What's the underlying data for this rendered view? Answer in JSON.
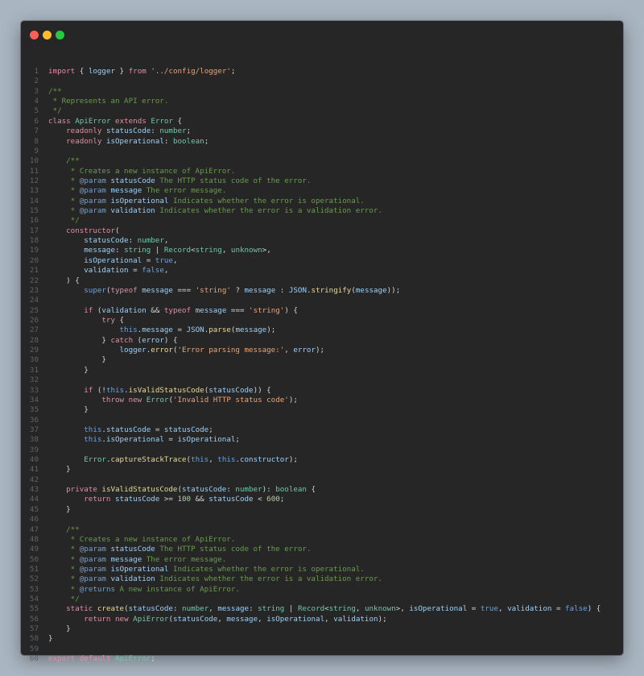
{
  "window": {
    "controls": [
      {
        "name": "close-dot",
        "color": "#ff5f57"
      },
      {
        "name": "minimize-dot",
        "color": "#febc2e"
      },
      {
        "name": "maximize-dot",
        "color": "#28c840"
      }
    ]
  },
  "code": {
    "lines": [
      [
        [
          "kw",
          "import"
        ],
        [
          "pl",
          " { "
        ],
        [
          "var",
          "logger"
        ],
        [
          "pl",
          " } "
        ],
        [
          "kw",
          "from"
        ],
        [
          "pl",
          " "
        ],
        [
          "str",
          "'../config/logger'"
        ],
        [
          "pl",
          ";"
        ]
      ],
      [],
      [
        [
          "cm",
          "/**"
        ]
      ],
      [
        [
          "cm",
          " * Represents an API error."
        ]
      ],
      [
        [
          "cm",
          " */"
        ]
      ],
      [
        [
          "kw",
          "class"
        ],
        [
          "pl",
          " "
        ],
        [
          "ty",
          "ApiError"
        ],
        [
          "pl",
          " "
        ],
        [
          "kw",
          "extends"
        ],
        [
          "pl",
          " "
        ],
        [
          "ty",
          "Error"
        ],
        [
          "pl",
          " {"
        ]
      ],
      [
        [
          "pl",
          "    "
        ],
        [
          "kw",
          "readonly"
        ],
        [
          "pl",
          " "
        ],
        [
          "var",
          "statusCode"
        ],
        [
          "pl",
          ": "
        ],
        [
          "ty",
          "number"
        ],
        [
          "pl",
          ";"
        ]
      ],
      [
        [
          "pl",
          "    "
        ],
        [
          "kw",
          "readonly"
        ],
        [
          "pl",
          " "
        ],
        [
          "var",
          "isOperational"
        ],
        [
          "pl",
          ": "
        ],
        [
          "ty",
          "boolean"
        ],
        [
          "pl",
          ";"
        ]
      ],
      [],
      [
        [
          "pl",
          "    "
        ],
        [
          "cm",
          "/**"
        ]
      ],
      [
        [
          "pl",
          "    "
        ],
        [
          "cm",
          " * Creates a new instance of ApiError."
        ]
      ],
      [
        [
          "pl",
          "    "
        ],
        [
          "cm",
          " * "
        ],
        [
          "cmtag",
          "@param"
        ],
        [
          "pl",
          " "
        ],
        [
          "var",
          "statusCode"
        ],
        [
          "cm",
          " The HTTP status code of the error."
        ]
      ],
      [
        [
          "pl",
          "    "
        ],
        [
          "cm",
          " * "
        ],
        [
          "cmtag",
          "@param"
        ],
        [
          "pl",
          " "
        ],
        [
          "var",
          "message"
        ],
        [
          "cm",
          " The error message."
        ]
      ],
      [
        [
          "pl",
          "    "
        ],
        [
          "cm",
          " * "
        ],
        [
          "cmtag",
          "@param"
        ],
        [
          "pl",
          " "
        ],
        [
          "var",
          "isOperational"
        ],
        [
          "cm",
          " Indicates whether the error is operational."
        ]
      ],
      [
        [
          "pl",
          "    "
        ],
        [
          "cm",
          " * "
        ],
        [
          "cmtag",
          "@param"
        ],
        [
          "pl",
          " "
        ],
        [
          "var",
          "validation"
        ],
        [
          "cm",
          " Indicates whether the error is a validation error."
        ]
      ],
      [
        [
          "pl",
          "    "
        ],
        [
          "cm",
          " */"
        ]
      ],
      [
        [
          "pl",
          "    "
        ],
        [
          "kw",
          "constructor"
        ],
        [
          "pl",
          "("
        ]
      ],
      [
        [
          "pl",
          "        "
        ],
        [
          "var",
          "statusCode"
        ],
        [
          "pl",
          ": "
        ],
        [
          "ty",
          "number"
        ],
        [
          "pl",
          ","
        ]
      ],
      [
        [
          "pl",
          "        "
        ],
        [
          "var",
          "message"
        ],
        [
          "pl",
          ": "
        ],
        [
          "ty",
          "string"
        ],
        [
          "pl",
          " | "
        ],
        [
          "ty",
          "Record"
        ],
        [
          "pl",
          "<"
        ],
        [
          "ty",
          "string"
        ],
        [
          "pl",
          ", "
        ],
        [
          "ty",
          "unknown"
        ],
        [
          "pl",
          ">,"
        ]
      ],
      [
        [
          "pl",
          "        "
        ],
        [
          "var",
          "isOperational"
        ],
        [
          "pl",
          " = "
        ],
        [
          "kw2",
          "true"
        ],
        [
          "pl",
          ","
        ]
      ],
      [
        [
          "pl",
          "        "
        ],
        [
          "var",
          "validation"
        ],
        [
          "pl",
          " = "
        ],
        [
          "kw2",
          "false"
        ],
        [
          "pl",
          ","
        ]
      ],
      [
        [
          "pl",
          "    ) {"
        ]
      ],
      [
        [
          "pl",
          "        "
        ],
        [
          "kw2",
          "super"
        ],
        [
          "pl",
          "("
        ],
        [
          "kw",
          "typeof"
        ],
        [
          "pl",
          " "
        ],
        [
          "var",
          "message"
        ],
        [
          "pl",
          " === "
        ],
        [
          "str",
          "'string'"
        ],
        [
          "pl",
          " ? "
        ],
        [
          "var",
          "message"
        ],
        [
          "pl",
          " : "
        ],
        [
          "var",
          "JSON"
        ],
        [
          "pl",
          "."
        ],
        [
          "fn",
          "stringify"
        ],
        [
          "pl",
          "("
        ],
        [
          "var",
          "message"
        ],
        [
          "pl",
          "));"
        ]
      ],
      [],
      [
        [
          "pl",
          "        "
        ],
        [
          "kw",
          "if"
        ],
        [
          "pl",
          " ("
        ],
        [
          "var",
          "validation"
        ],
        [
          "pl",
          " && "
        ],
        [
          "kw",
          "typeof"
        ],
        [
          "pl",
          " "
        ],
        [
          "var",
          "message"
        ],
        [
          "pl",
          " === "
        ],
        [
          "str",
          "'string'"
        ],
        [
          "pl",
          ") {"
        ]
      ],
      [
        [
          "pl",
          "            "
        ],
        [
          "kw",
          "try"
        ],
        [
          "pl",
          " {"
        ]
      ],
      [
        [
          "pl",
          "                "
        ],
        [
          "kw2",
          "this"
        ],
        [
          "pl",
          "."
        ],
        [
          "var",
          "message"
        ],
        [
          "pl",
          " = "
        ],
        [
          "var",
          "JSON"
        ],
        [
          "pl",
          "."
        ],
        [
          "fn",
          "parse"
        ],
        [
          "pl",
          "("
        ],
        [
          "var",
          "message"
        ],
        [
          "pl",
          ");"
        ]
      ],
      [
        [
          "pl",
          "            } "
        ],
        [
          "kw",
          "catch"
        ],
        [
          "pl",
          " ("
        ],
        [
          "var",
          "error"
        ],
        [
          "pl",
          ") {"
        ]
      ],
      [
        [
          "pl",
          "                "
        ],
        [
          "var",
          "logger"
        ],
        [
          "pl",
          "."
        ],
        [
          "fn",
          "error"
        ],
        [
          "pl",
          "("
        ],
        [
          "str",
          "'Error parsing message:'"
        ],
        [
          "pl",
          ", "
        ],
        [
          "var",
          "error"
        ],
        [
          "pl",
          ");"
        ]
      ],
      [
        [
          "pl",
          "            }"
        ]
      ],
      [
        [
          "pl",
          "        }"
        ]
      ],
      [],
      [
        [
          "pl",
          "        "
        ],
        [
          "kw",
          "if"
        ],
        [
          "pl",
          " (!"
        ],
        [
          "kw2",
          "this"
        ],
        [
          "pl",
          "."
        ],
        [
          "fn",
          "isValidStatusCode"
        ],
        [
          "pl",
          "("
        ],
        [
          "var",
          "statusCode"
        ],
        [
          "pl",
          ")) {"
        ]
      ],
      [
        [
          "pl",
          "            "
        ],
        [
          "kw",
          "throw"
        ],
        [
          "pl",
          " "
        ],
        [
          "kw",
          "new"
        ],
        [
          "pl",
          " "
        ],
        [
          "ty",
          "Error"
        ],
        [
          "pl",
          "("
        ],
        [
          "str",
          "'Invalid HTTP status code'"
        ],
        [
          "pl",
          ");"
        ]
      ],
      [
        [
          "pl",
          "        }"
        ]
      ],
      [],
      [
        [
          "pl",
          "        "
        ],
        [
          "kw2",
          "this"
        ],
        [
          "pl",
          "."
        ],
        [
          "var",
          "statusCode"
        ],
        [
          "pl",
          " = "
        ],
        [
          "var",
          "statusCode"
        ],
        [
          "pl",
          ";"
        ]
      ],
      [
        [
          "pl",
          "        "
        ],
        [
          "kw2",
          "this"
        ],
        [
          "pl",
          "."
        ],
        [
          "var",
          "isOperational"
        ],
        [
          "pl",
          " = "
        ],
        [
          "var",
          "isOperational"
        ],
        [
          "pl",
          ";"
        ]
      ],
      [],
      [
        [
          "pl",
          "        "
        ],
        [
          "ty",
          "Error"
        ],
        [
          "pl",
          "."
        ],
        [
          "fn",
          "captureStackTrace"
        ],
        [
          "pl",
          "("
        ],
        [
          "kw2",
          "this"
        ],
        [
          "pl",
          ", "
        ],
        [
          "kw2",
          "this"
        ],
        [
          "pl",
          "."
        ],
        [
          "var",
          "constructor"
        ],
        [
          "pl",
          ");"
        ]
      ],
      [
        [
          "pl",
          "    }"
        ]
      ],
      [],
      [
        [
          "pl",
          "    "
        ],
        [
          "kw",
          "private"
        ],
        [
          "pl",
          " "
        ],
        [
          "fn",
          "isValidStatusCode"
        ],
        [
          "pl",
          "("
        ],
        [
          "var",
          "statusCode"
        ],
        [
          "pl",
          ": "
        ],
        [
          "ty",
          "number"
        ],
        [
          "pl",
          "): "
        ],
        [
          "ty",
          "boolean"
        ],
        [
          "pl",
          " {"
        ]
      ],
      [
        [
          "pl",
          "        "
        ],
        [
          "kw",
          "return"
        ],
        [
          "pl",
          " "
        ],
        [
          "var",
          "statusCode"
        ],
        [
          "pl",
          " >= "
        ],
        [
          "num",
          "100"
        ],
        [
          "pl",
          " && "
        ],
        [
          "var",
          "statusCode"
        ],
        [
          "pl",
          " < "
        ],
        [
          "num",
          "600"
        ],
        [
          "pl",
          ";"
        ]
      ],
      [
        [
          "pl",
          "    }"
        ]
      ],
      [],
      [
        [
          "pl",
          "    "
        ],
        [
          "cm",
          "/**"
        ]
      ],
      [
        [
          "pl",
          "    "
        ],
        [
          "cm",
          " * Creates a new instance of ApiError."
        ]
      ],
      [
        [
          "pl",
          "    "
        ],
        [
          "cm",
          " * "
        ],
        [
          "cmtag",
          "@param"
        ],
        [
          "pl",
          " "
        ],
        [
          "var",
          "statusCode"
        ],
        [
          "cm",
          " The HTTP status code of the error."
        ]
      ],
      [
        [
          "pl",
          "    "
        ],
        [
          "cm",
          " * "
        ],
        [
          "cmtag",
          "@param"
        ],
        [
          "pl",
          " "
        ],
        [
          "var",
          "message"
        ],
        [
          "cm",
          " The error message."
        ]
      ],
      [
        [
          "pl",
          "    "
        ],
        [
          "cm",
          " * "
        ],
        [
          "cmtag",
          "@param"
        ],
        [
          "pl",
          " "
        ],
        [
          "var",
          "isOperational"
        ],
        [
          "cm",
          " Indicates whether the error is operational."
        ]
      ],
      [
        [
          "pl",
          "    "
        ],
        [
          "cm",
          " * "
        ],
        [
          "cmtag",
          "@param"
        ],
        [
          "pl",
          " "
        ],
        [
          "var",
          "validation"
        ],
        [
          "cm",
          " Indicates whether the error is a validation error."
        ]
      ],
      [
        [
          "pl",
          "    "
        ],
        [
          "cm",
          " * "
        ],
        [
          "cmtag",
          "@returns"
        ],
        [
          "cm",
          " A new instance of ApiError."
        ]
      ],
      [
        [
          "pl",
          "    "
        ],
        [
          "cm",
          " */"
        ]
      ],
      [
        [
          "pl",
          "    "
        ],
        [
          "kw",
          "static"
        ],
        [
          "pl",
          " "
        ],
        [
          "fn",
          "create"
        ],
        [
          "pl",
          "("
        ],
        [
          "var",
          "statusCode"
        ],
        [
          "pl",
          ": "
        ],
        [
          "ty",
          "number"
        ],
        [
          "pl",
          ", "
        ],
        [
          "var",
          "message"
        ],
        [
          "pl",
          ": "
        ],
        [
          "ty",
          "string"
        ],
        [
          "pl",
          " | "
        ],
        [
          "ty",
          "Record"
        ],
        [
          "pl",
          "<"
        ],
        [
          "ty",
          "string"
        ],
        [
          "pl",
          ", "
        ],
        [
          "ty",
          "unknown"
        ],
        [
          "pl",
          ">, "
        ],
        [
          "var",
          "isOperational"
        ],
        [
          "pl",
          " = "
        ],
        [
          "kw2",
          "true"
        ],
        [
          "pl",
          ", "
        ],
        [
          "var",
          "validation"
        ],
        [
          "pl",
          " = "
        ],
        [
          "kw2",
          "false"
        ],
        [
          "pl",
          ") {"
        ]
      ],
      [
        [
          "pl",
          "        "
        ],
        [
          "kw",
          "return"
        ],
        [
          "pl",
          " "
        ],
        [
          "kw",
          "new"
        ],
        [
          "pl",
          " "
        ],
        [
          "ty",
          "ApiError"
        ],
        [
          "pl",
          "("
        ],
        [
          "var",
          "statusCode"
        ],
        [
          "pl",
          ", "
        ],
        [
          "var",
          "message"
        ],
        [
          "pl",
          ", "
        ],
        [
          "var",
          "isOperational"
        ],
        [
          "pl",
          ", "
        ],
        [
          "var",
          "validation"
        ],
        [
          "pl",
          ");"
        ]
      ],
      [
        [
          "pl",
          "    }"
        ]
      ],
      [
        [
          "pl",
          "}"
        ]
      ],
      [],
      [
        [
          "kw",
          "export"
        ],
        [
          "pl",
          " "
        ],
        [
          "kw",
          "default"
        ],
        [
          "pl",
          " "
        ],
        [
          "ty",
          "ApiError"
        ],
        [
          "pl",
          ";"
        ]
      ]
    ]
  }
}
